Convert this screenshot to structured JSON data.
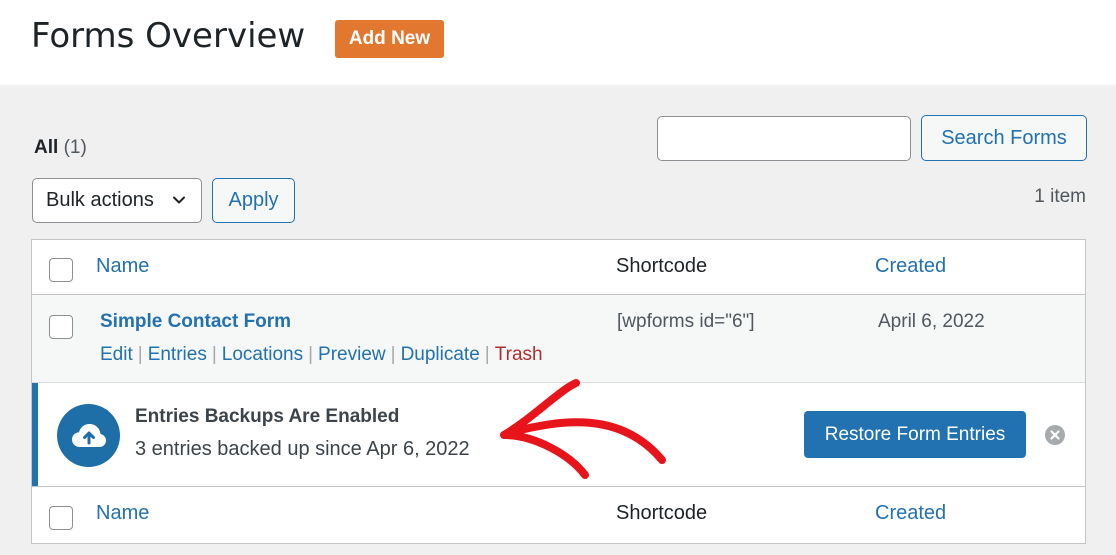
{
  "header": {
    "title": "Forms Overview",
    "add_new_label": "Add New"
  },
  "filters": {
    "all_label": "All",
    "all_count": "(1)"
  },
  "search": {
    "value": "",
    "button_label": "Search Forms"
  },
  "bulk": {
    "select_value": "Bulk actions",
    "apply_label": "Apply",
    "item_count": "1 item"
  },
  "table": {
    "columns": [
      "Name",
      "Shortcode",
      "Created"
    ],
    "rows": [
      {
        "name": "Simple Contact Form",
        "shortcode": "[wpforms id=\"6\"]",
        "created": "April 6, 2022",
        "actions": [
          "Edit",
          "Entries",
          "Locations",
          "Preview",
          "Duplicate",
          "Trash"
        ]
      }
    ]
  },
  "notice": {
    "title": "Entries Backups Are Enabled",
    "description": "3 entries backed up since Apr 6, 2022",
    "button_label": "Restore Form Entries",
    "icon": "cloud-upload-icon"
  },
  "colors": {
    "accent": "#2271b1",
    "add_new": "#e27730",
    "trash": "#b32d2e",
    "annotation": "#e8141c"
  }
}
